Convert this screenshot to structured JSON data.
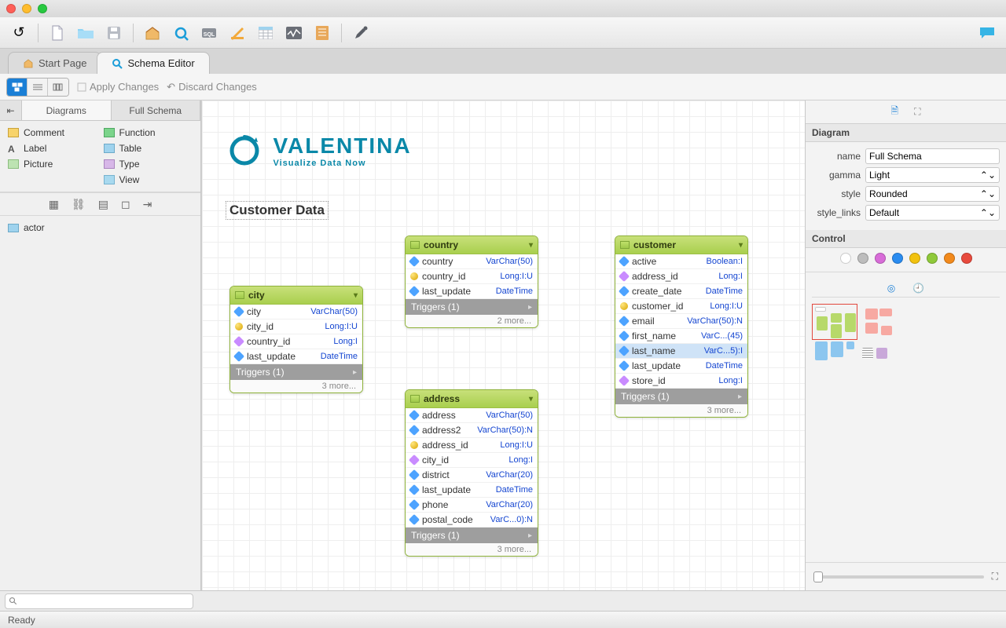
{
  "tabs": {
    "start": "Start Page",
    "schema": "Schema Editor"
  },
  "subtoolbar": {
    "apply": "Apply Changes",
    "discard": "Discard Changes"
  },
  "left": {
    "tabs": {
      "diagrams": "Diagrams",
      "full": "Full Schema"
    },
    "palette": {
      "comment": "Comment",
      "function": "Function",
      "label": "Label",
      "table": "Table",
      "picture": "Picture",
      "type": "Type",
      "view": "View"
    },
    "tree": {
      "actor": "actor"
    }
  },
  "brand": {
    "name": "VALENTINA",
    "tag": "Visualize Data Now"
  },
  "section": "Customer Data",
  "entities": {
    "city": {
      "title": "city",
      "rows": [
        {
          "n": "city",
          "t": "VarChar(50)",
          "k": "fld"
        },
        {
          "n": "city_id",
          "t": "Long:I:U",
          "k": "pk"
        },
        {
          "n": "country_id",
          "t": "Long:I",
          "k": "fk"
        },
        {
          "n": "last_update",
          "t": "DateTime",
          "k": "fld"
        }
      ],
      "trig": "Triggers (1)",
      "more": "3 more..."
    },
    "country": {
      "title": "country",
      "rows": [
        {
          "n": "country",
          "t": "VarChar(50)",
          "k": "fld"
        },
        {
          "n": "country_id",
          "t": "Long:I:U",
          "k": "pk"
        },
        {
          "n": "last_update",
          "t": "DateTime",
          "k": "fld"
        }
      ],
      "trig": "Triggers (1)",
      "more": "2 more..."
    },
    "address": {
      "title": "address",
      "rows": [
        {
          "n": "address",
          "t": "VarChar(50)",
          "k": "fld"
        },
        {
          "n": "address2",
          "t": "VarChar(50):N",
          "k": "fld"
        },
        {
          "n": "address_id",
          "t": "Long:I:U",
          "k": "pk"
        },
        {
          "n": "city_id",
          "t": "Long:I",
          "k": "fk"
        },
        {
          "n": "district",
          "t": "VarChar(20)",
          "k": "fld"
        },
        {
          "n": "last_update",
          "t": "DateTime",
          "k": "fld"
        },
        {
          "n": "phone",
          "t": "VarChar(20)",
          "k": "fld"
        },
        {
          "n": "postal_code",
          "t": "VarC...0):N",
          "k": "fld"
        }
      ],
      "trig": "Triggers (1)",
      "more": "3 more..."
    },
    "customer": {
      "title": "customer",
      "rows": [
        {
          "n": "active",
          "t": "Boolean:I",
          "k": "fld"
        },
        {
          "n": "address_id",
          "t": "Long:I",
          "k": "fk"
        },
        {
          "n": "create_date",
          "t": "DateTime",
          "k": "fld"
        },
        {
          "n": "customer_id",
          "t": "Long:I:U",
          "k": "pk"
        },
        {
          "n": "email",
          "t": "VarChar(50):N",
          "k": "fld"
        },
        {
          "n": "first_name",
          "t": "VarC...(45)",
          "k": "fld"
        },
        {
          "n": "last_name",
          "t": "VarC...5):I",
          "k": "fld",
          "sel": true
        },
        {
          "n": "last_update",
          "t": "DateTime",
          "k": "fld"
        },
        {
          "n": "store_id",
          "t": "Long:I",
          "k": "fk"
        }
      ],
      "trig": "Triggers (1)",
      "more": "3 more..."
    }
  },
  "inspector": {
    "section1": "Diagram",
    "name_label": "name",
    "name_value": "Full Schema",
    "gamma_label": "gamma",
    "gamma_value": "Light",
    "style_label": "style",
    "style_value": "Rounded",
    "links_label": "style_links",
    "links_value": "Default",
    "section2": "Control",
    "colors": [
      "#ffffff",
      "#bdbdbd",
      "#d86cd8",
      "#2a8cf0",
      "#f2c20f",
      "#8fc93a",
      "#f28a1c",
      "#e84a3d"
    ]
  },
  "search_placeholder": "",
  "status": "Ready"
}
